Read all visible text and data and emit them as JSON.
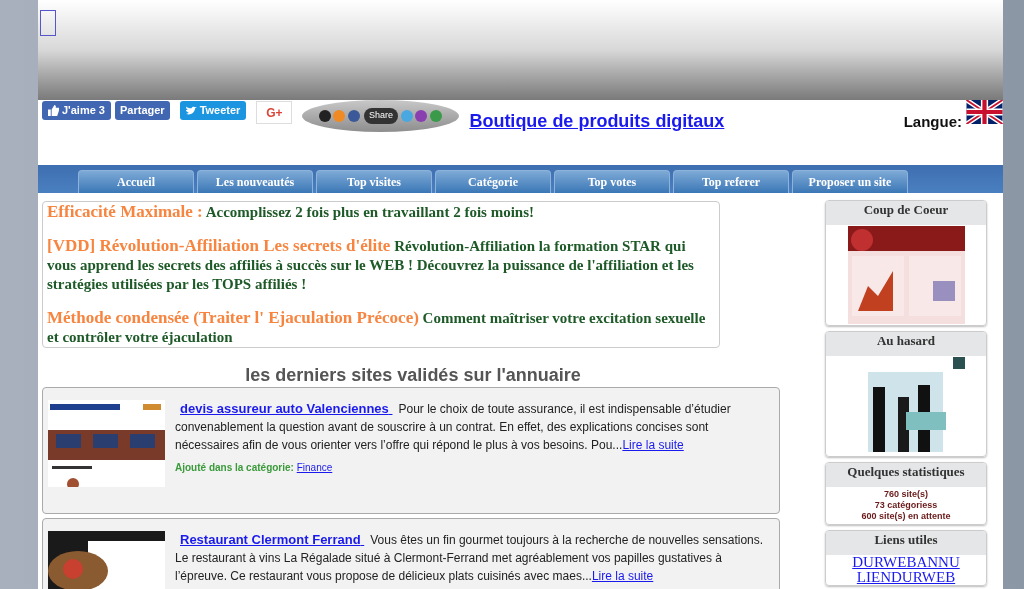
{
  "social": {
    "like": "J'aime 3",
    "share_fb": "Partager",
    "tweet": "Tweeter",
    "gplus": "G+",
    "share_widget": "Share"
  },
  "header": {
    "shop_link": "Boutique de produits digitaux",
    "language_label": "Langue:"
  },
  "nav": [
    {
      "label": "Accueil"
    },
    {
      "label": "Les nouveautés"
    },
    {
      "label": "Top visites"
    },
    {
      "label": "Catégorie"
    },
    {
      "label": "Top votes"
    },
    {
      "label": "Top referer"
    },
    {
      "label": "Proposer un site"
    }
  ],
  "ads": [
    {
      "title": "Efficacité Maximale :",
      "text": "Accomplissez 2 fois plus en travaillant 2 fois moins!"
    },
    {
      "title": "[VDD] Révolution-Affiliation Les secrets d'élite",
      "text": "Révolution-Affiliation la formation STAR qui vous apprend les secrets des affiliés à succès sur le WEB ! Découvrez la puissance de l'affiliation et les stratégies utilisées par les TOPS affiliés !"
    },
    {
      "title": "Méthode condensée (Traiter l' Ejaculation Précoce)",
      "text": "Comment maîtriser votre excitation sexuelle et contrôler votre éjaculation"
    }
  ],
  "section_title": "les derniers sites validés sur l'annuaire",
  "listings": [
    {
      "title": "devis assureur auto Valenciennes",
      "description": "Pour le choix de toute assurance, il est indispensable d’étudier convenablement la question avant de souscrire à un contrat. En effet, des explications concises sont nécessaires afin de vous orienter vers l’offre qui répond le plus à vos besoins. Pou...",
      "more": "Lire la suite",
      "category_label": "Ajouté dans la catégorie:",
      "category": "Finance"
    },
    {
      "title": "Restaurant Clermont Ferrand",
      "description": "Vous êtes un fin gourmet toujours à la recherche de nouvelles sensations. Le restaurant à vins La Régalade situé à Clermont-Ferrand met agréablement vos papilles gustatives à l’épreuve. Ce restaurant vous propose de délicieux plats cuisinés avec maes...",
      "more": "Lire la suite"
    }
  ],
  "sidebar": [
    {
      "title": "Coup de Coeur",
      "kind": "picture"
    },
    {
      "title": "Au hasard",
      "kind": "picture"
    },
    {
      "title": "Quelques statistiques",
      "kind": "stats",
      "lines": [
        "760 site(s)",
        "73 catégoriess",
        "600 site(s) en attente"
      ]
    },
    {
      "title": "Liens utiles",
      "kind": "links",
      "lines": [
        "DURWEBANNU",
        "LIENDURWEB"
      ]
    }
  ]
}
